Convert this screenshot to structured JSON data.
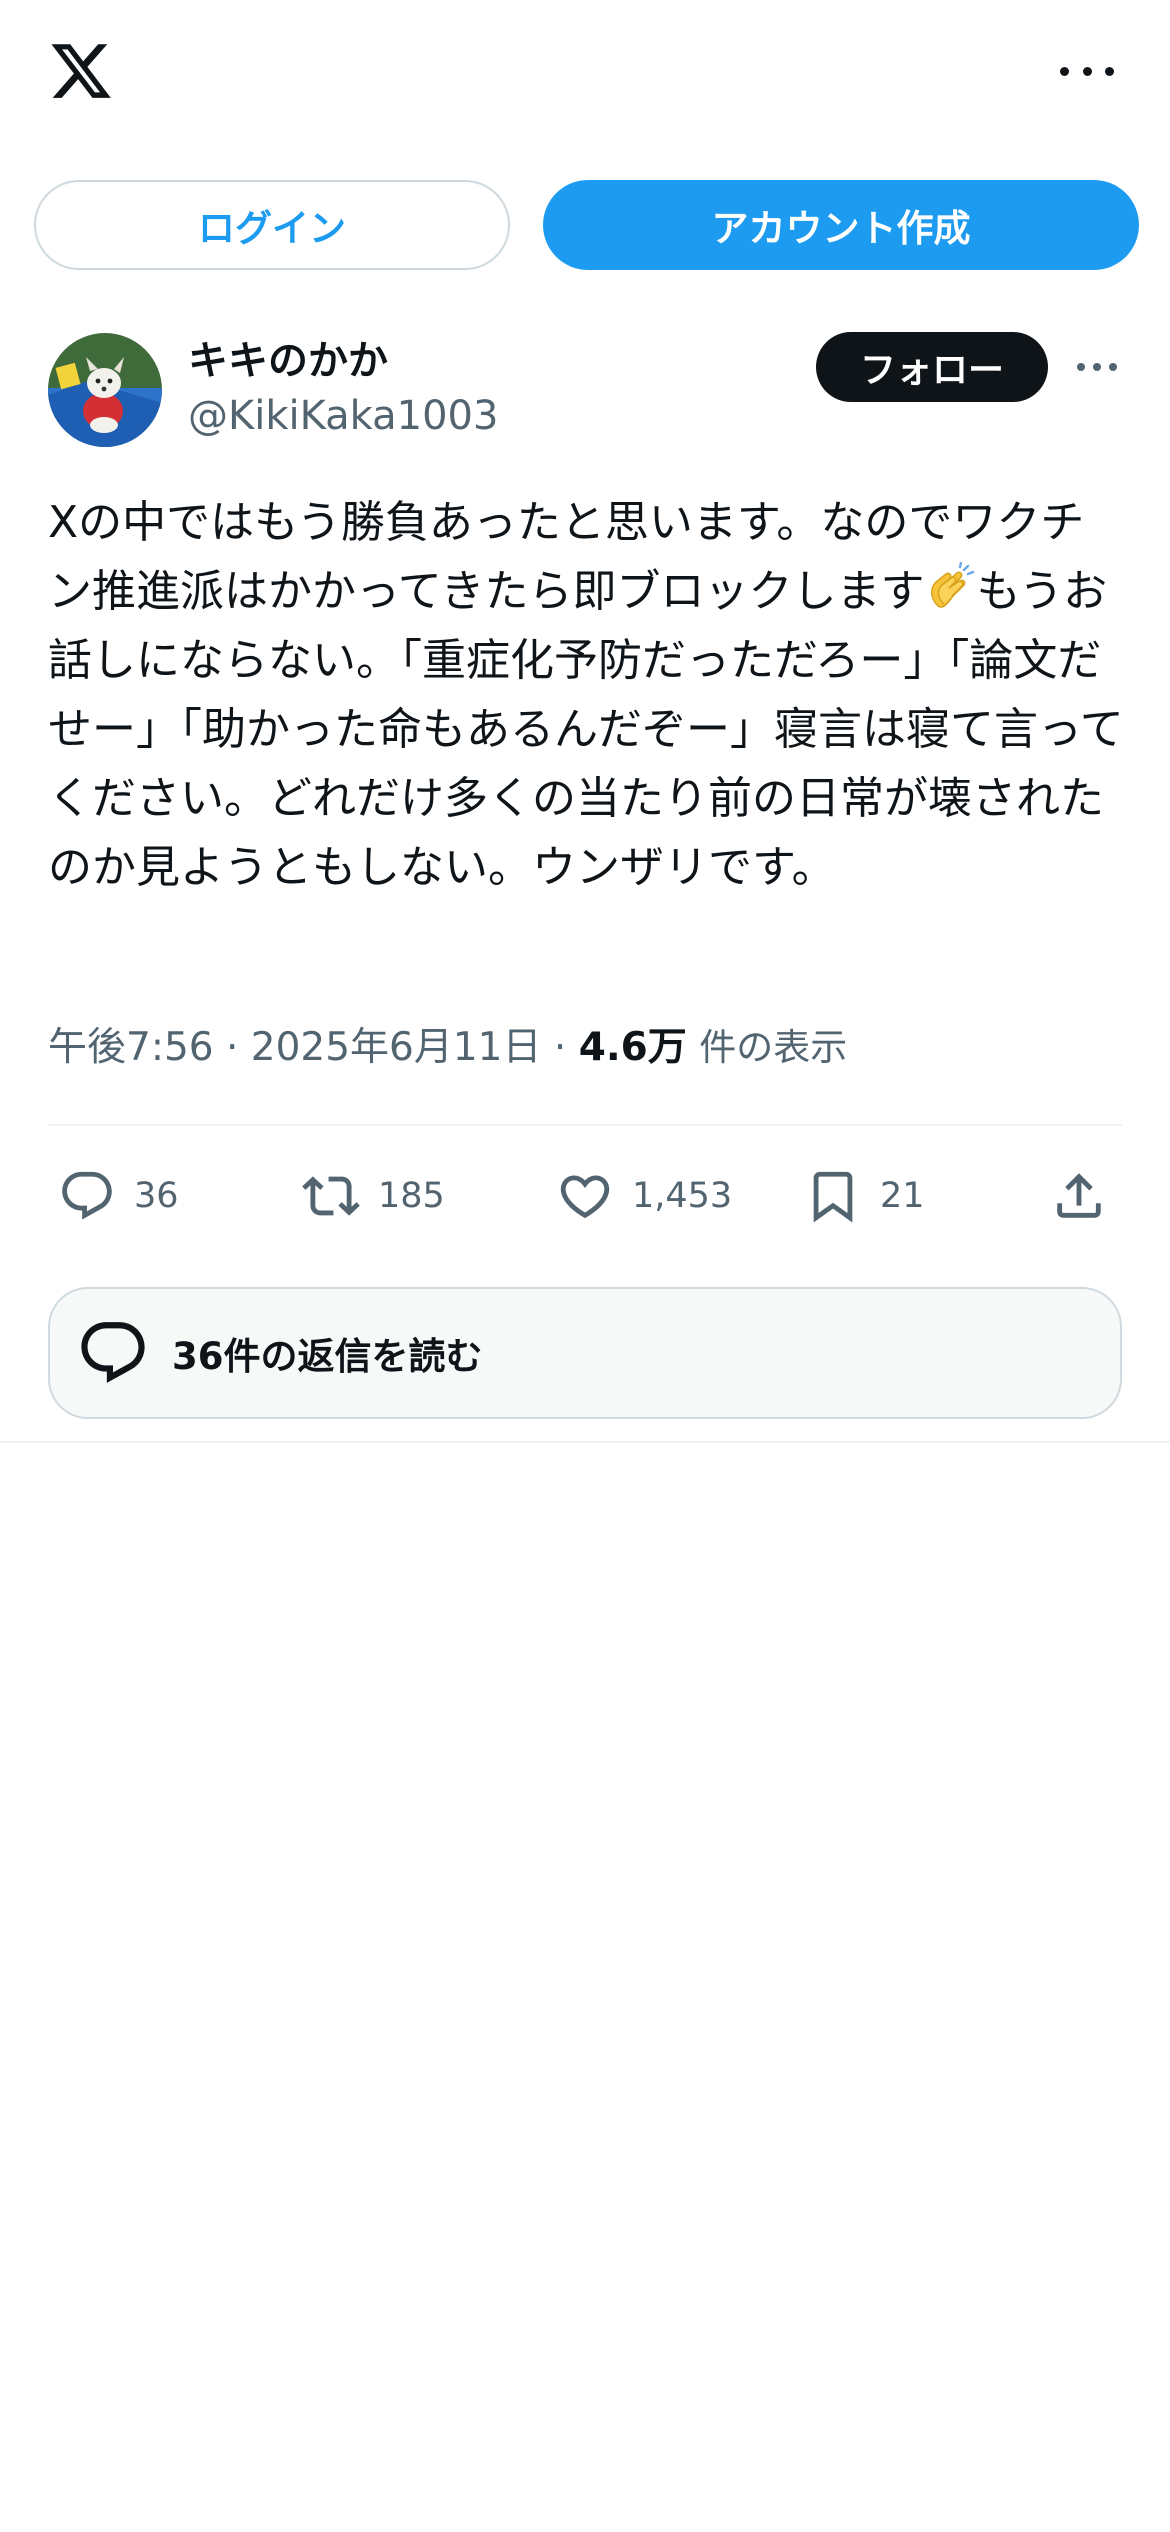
{
  "header": {
    "logo_icon": "x-logo-icon",
    "more_icon": "more-horizontal-icon"
  },
  "auth": {
    "login_label": "ログイン",
    "signup_label": "アカウント作成"
  },
  "author": {
    "display_name": "キキのかか",
    "handle": "@KikiKaka1003",
    "follow_label": "フォロー",
    "avatar_icon": "dog-avatar"
  },
  "tweet": {
    "text_before_emoji": "Xの中ではもう勝負あったと思います。なのでワクチン推進派はかかってきたら即ブロックします",
    "emoji_icon": "clapping-hands-emoji",
    "text_after_emoji": "もうお話しにならない。「重症化予防だっただろー」「論文だせー」「助かった命もあるんだぞー」寝言は寝て言ってください。どれだけ多くの当たり前の日常が壊されたのか見ようともしない。ウンザリです。",
    "time": "午後7:56",
    "separator": " · ",
    "date": "2025年6月11日",
    "views_count": "4.6万",
    "views_label": "件の表示"
  },
  "actions": {
    "reply_count": "36",
    "retweet_count": "185",
    "like_count": "1,453",
    "bookmark_count": "21"
  },
  "replies": {
    "read_label": "36件の返信を読む"
  },
  "colors": {
    "accent": "#1d9bf0",
    "text_primary": "#0f1419",
    "text_secondary": "#536471",
    "border": "#cfd9de"
  }
}
